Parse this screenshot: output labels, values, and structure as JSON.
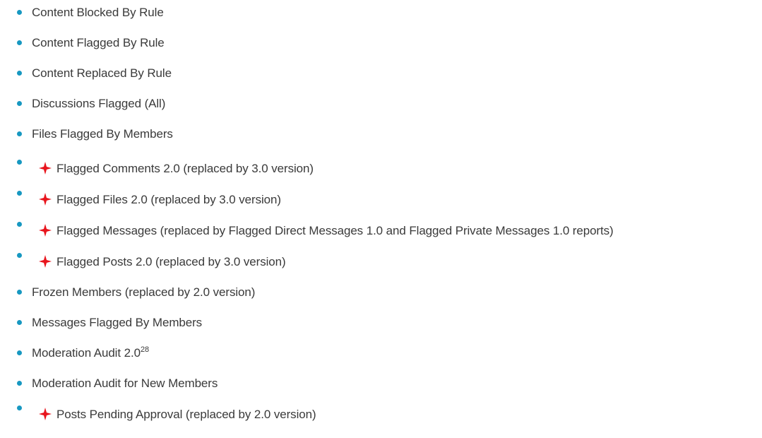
{
  "items": [
    {
      "label": "Content Blocked By Rule",
      "flag": false
    },
    {
      "label": "Content Flagged By Rule",
      "flag": false
    },
    {
      "label": "Content Replaced By Rule",
      "flag": false
    },
    {
      "label": "Discussions Flagged (All)",
      "flag": false
    },
    {
      "label": "Files Flagged By Members",
      "flag": false
    },
    {
      "label": "Flagged Comments 2.0 (replaced by 3.0 version)",
      "flag": true
    },
    {
      "label": "Flagged Files 2.0 (replaced by 3.0 version)",
      "flag": true
    },
    {
      "label": "Flagged Messages (replaced by Flagged Direct Messages 1.0 and Flagged Private Messages 1.0 reports)",
      "flag": true
    },
    {
      "label": "Flagged Posts 2.0 (replaced by 3.0 version)",
      "flag": true
    },
    {
      "label": "Frozen Members (replaced by 2.0 version)",
      "flag": false
    },
    {
      "label": "Messages Flagged By Members",
      "flag": false
    },
    {
      "label": "Moderation Audit 2.0",
      "flag": false,
      "footnote": "28"
    },
    {
      "label": "Moderation Audit for New Members",
      "flag": false
    },
    {
      "label": "Posts Pending Approval (replaced by 2.0 version)",
      "flag": true
    }
  ],
  "colors": {
    "bullet": "#1798c1",
    "text": "#3a3a3a",
    "flag_icon": "#e8141c"
  },
  "icons": {
    "flag": "red-four-point-star-icon"
  }
}
